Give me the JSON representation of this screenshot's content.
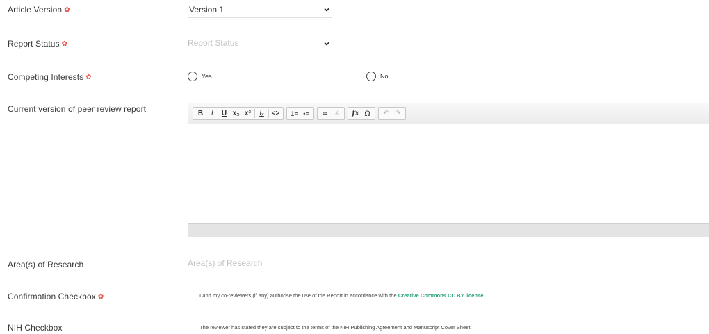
{
  "fields": {
    "article_version": {
      "label": "Article Version",
      "required_mark": "✿",
      "value": "Version 1"
    },
    "report_status": {
      "label": "Report Status",
      "required_mark": "✿",
      "placeholder": "Report Status"
    },
    "competing_interests": {
      "label": "Competing Interests",
      "required_mark": "✿",
      "options": [
        {
          "label": "Yes"
        },
        {
          "label": "No"
        }
      ]
    },
    "peer_review_report": {
      "label": "Current version of peer review report",
      "toolbar": {
        "bold": "B",
        "italic": "I",
        "underline": "U",
        "subscript": "x₂",
        "superscript": "x²",
        "remove_format": "Iₓ",
        "source": "<>",
        "numbered_list": "1≡",
        "bulleted_list": "•≡",
        "link": "∞",
        "unlink": "≠",
        "formula": "fx",
        "special_char": "Ω",
        "undo": "↶",
        "redo": "↷"
      }
    },
    "areas_of_research": {
      "label": "Area(s) of Research",
      "placeholder": "Area(s) of Research"
    },
    "confirmation": {
      "label": "Confirmation Checkbox",
      "required_mark": "✿",
      "text": "I and my co-reviewers (if any) authorise the use of the Report in accordance with the ",
      "link_text": "Creative Commons CC BY license",
      "text_end": "."
    },
    "nih": {
      "label": "NIH Checkbox",
      "text": "The reviewer has stated they are subject to the terms of the NIH Publishing Agreement and Manuscript Cover Sheet."
    }
  },
  "colors": {
    "required": "#e8554e",
    "link": "#2aa37a",
    "placeholder": "#c2c2c2"
  }
}
